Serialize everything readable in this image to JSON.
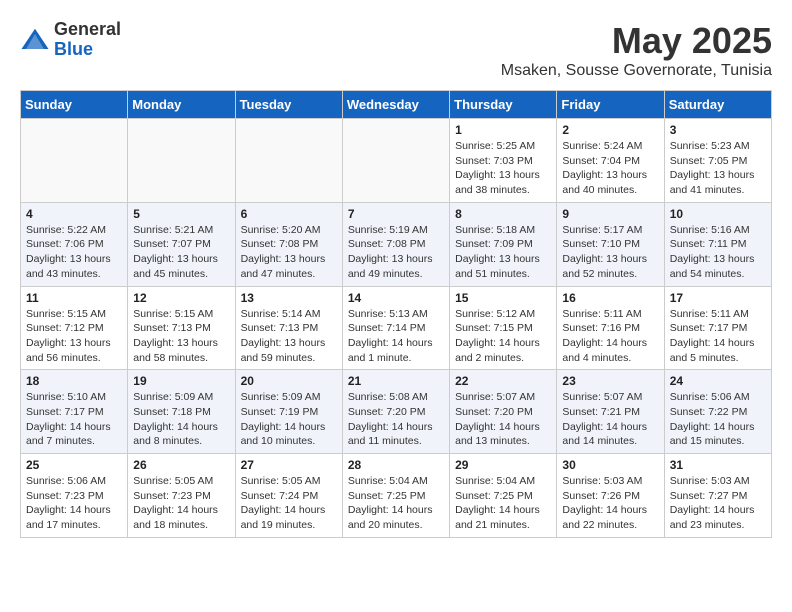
{
  "header": {
    "logo_general": "General",
    "logo_blue": "Blue",
    "month_year": "May 2025",
    "location": "Msaken, Sousse Governorate, Tunisia"
  },
  "days_of_week": [
    "Sunday",
    "Monday",
    "Tuesday",
    "Wednesday",
    "Thursday",
    "Friday",
    "Saturday"
  ],
  "weeks": [
    [
      {
        "day": "",
        "info": ""
      },
      {
        "day": "",
        "info": ""
      },
      {
        "day": "",
        "info": ""
      },
      {
        "day": "",
        "info": ""
      },
      {
        "day": "1",
        "info": "Sunrise: 5:25 AM\nSunset: 7:03 PM\nDaylight: 13 hours\nand 38 minutes."
      },
      {
        "day": "2",
        "info": "Sunrise: 5:24 AM\nSunset: 7:04 PM\nDaylight: 13 hours\nand 40 minutes."
      },
      {
        "day": "3",
        "info": "Sunrise: 5:23 AM\nSunset: 7:05 PM\nDaylight: 13 hours\nand 41 minutes."
      }
    ],
    [
      {
        "day": "4",
        "info": "Sunrise: 5:22 AM\nSunset: 7:06 PM\nDaylight: 13 hours\nand 43 minutes."
      },
      {
        "day": "5",
        "info": "Sunrise: 5:21 AM\nSunset: 7:07 PM\nDaylight: 13 hours\nand 45 minutes."
      },
      {
        "day": "6",
        "info": "Sunrise: 5:20 AM\nSunset: 7:08 PM\nDaylight: 13 hours\nand 47 minutes."
      },
      {
        "day": "7",
        "info": "Sunrise: 5:19 AM\nSunset: 7:08 PM\nDaylight: 13 hours\nand 49 minutes."
      },
      {
        "day": "8",
        "info": "Sunrise: 5:18 AM\nSunset: 7:09 PM\nDaylight: 13 hours\nand 51 minutes."
      },
      {
        "day": "9",
        "info": "Sunrise: 5:17 AM\nSunset: 7:10 PM\nDaylight: 13 hours\nand 52 minutes."
      },
      {
        "day": "10",
        "info": "Sunrise: 5:16 AM\nSunset: 7:11 PM\nDaylight: 13 hours\nand 54 minutes."
      }
    ],
    [
      {
        "day": "11",
        "info": "Sunrise: 5:15 AM\nSunset: 7:12 PM\nDaylight: 13 hours\nand 56 minutes."
      },
      {
        "day": "12",
        "info": "Sunrise: 5:15 AM\nSunset: 7:13 PM\nDaylight: 13 hours\nand 58 minutes."
      },
      {
        "day": "13",
        "info": "Sunrise: 5:14 AM\nSunset: 7:13 PM\nDaylight: 13 hours\nand 59 minutes."
      },
      {
        "day": "14",
        "info": "Sunrise: 5:13 AM\nSunset: 7:14 PM\nDaylight: 14 hours\nand 1 minute."
      },
      {
        "day": "15",
        "info": "Sunrise: 5:12 AM\nSunset: 7:15 PM\nDaylight: 14 hours\nand 2 minutes."
      },
      {
        "day": "16",
        "info": "Sunrise: 5:11 AM\nSunset: 7:16 PM\nDaylight: 14 hours\nand 4 minutes."
      },
      {
        "day": "17",
        "info": "Sunrise: 5:11 AM\nSunset: 7:17 PM\nDaylight: 14 hours\nand 5 minutes."
      }
    ],
    [
      {
        "day": "18",
        "info": "Sunrise: 5:10 AM\nSunset: 7:17 PM\nDaylight: 14 hours\nand 7 minutes."
      },
      {
        "day": "19",
        "info": "Sunrise: 5:09 AM\nSunset: 7:18 PM\nDaylight: 14 hours\nand 8 minutes."
      },
      {
        "day": "20",
        "info": "Sunrise: 5:09 AM\nSunset: 7:19 PM\nDaylight: 14 hours\nand 10 minutes."
      },
      {
        "day": "21",
        "info": "Sunrise: 5:08 AM\nSunset: 7:20 PM\nDaylight: 14 hours\nand 11 minutes."
      },
      {
        "day": "22",
        "info": "Sunrise: 5:07 AM\nSunset: 7:20 PM\nDaylight: 14 hours\nand 13 minutes."
      },
      {
        "day": "23",
        "info": "Sunrise: 5:07 AM\nSunset: 7:21 PM\nDaylight: 14 hours\nand 14 minutes."
      },
      {
        "day": "24",
        "info": "Sunrise: 5:06 AM\nSunset: 7:22 PM\nDaylight: 14 hours\nand 15 minutes."
      }
    ],
    [
      {
        "day": "25",
        "info": "Sunrise: 5:06 AM\nSunset: 7:23 PM\nDaylight: 14 hours\nand 17 minutes."
      },
      {
        "day": "26",
        "info": "Sunrise: 5:05 AM\nSunset: 7:23 PM\nDaylight: 14 hours\nand 18 minutes."
      },
      {
        "day": "27",
        "info": "Sunrise: 5:05 AM\nSunset: 7:24 PM\nDaylight: 14 hours\nand 19 minutes."
      },
      {
        "day": "28",
        "info": "Sunrise: 5:04 AM\nSunset: 7:25 PM\nDaylight: 14 hours\nand 20 minutes."
      },
      {
        "day": "29",
        "info": "Sunrise: 5:04 AM\nSunset: 7:25 PM\nDaylight: 14 hours\nand 21 minutes."
      },
      {
        "day": "30",
        "info": "Sunrise: 5:03 AM\nSunset: 7:26 PM\nDaylight: 14 hours\nand 22 minutes."
      },
      {
        "day": "31",
        "info": "Sunrise: 5:03 AM\nSunset: 7:27 PM\nDaylight: 14 hours\nand 23 minutes."
      }
    ]
  ]
}
